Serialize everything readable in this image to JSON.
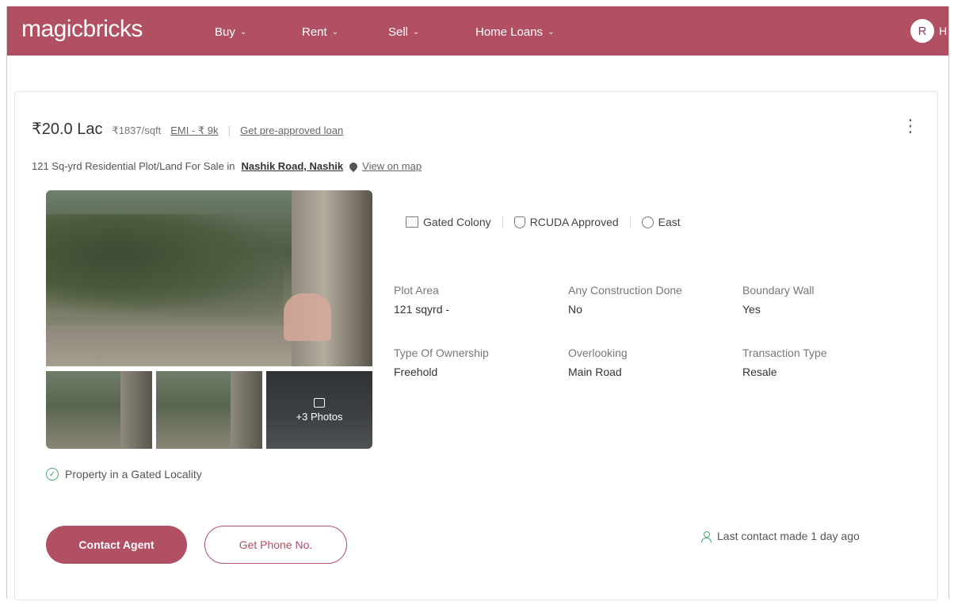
{
  "nav": {
    "logo": "magicbricks",
    "items": [
      {
        "label": "Buy"
      },
      {
        "label": "Rent"
      },
      {
        "label": "Sell"
      },
      {
        "label": "Home Loans"
      }
    ],
    "avatar_initial": "R",
    "avatar_extra": "H"
  },
  "listing": {
    "price": "₹20.0 Lac",
    "price_per_sqft": "₹1837/sqft",
    "emi": "EMI - ₹ 9k",
    "separator": "|",
    "loan_link": "Get pre-approved loan",
    "title_prefix": "121 Sq-yrd Residential Plot/Land For Sale in",
    "locality": "Nashik Road, Nashik",
    "map_link": "View on map",
    "more_photos": "+3 Photos",
    "gated_note": "Property in a Gated Locality",
    "features": [
      "Gated Colony",
      "RCUDA Approved",
      "East"
    ],
    "details": [
      {
        "label": "Plot Area",
        "value": "121 sqyrd -"
      },
      {
        "label": "Any Construction Done",
        "value": "No"
      },
      {
        "label": "Boundary Wall",
        "value": "Yes"
      },
      {
        "label": "Type Of Ownership",
        "value": "Freehold"
      },
      {
        "label": "Overlooking",
        "value": "Main Road"
      },
      {
        "label": "Transaction Type",
        "value": "Resale"
      }
    ],
    "contact_button": "Contact Agent",
    "phone_button": "Get Phone No.",
    "last_contact": "Last contact made 1 day ago"
  },
  "colors": {
    "brand": "#b14f63",
    "success": "#4aa36a"
  }
}
